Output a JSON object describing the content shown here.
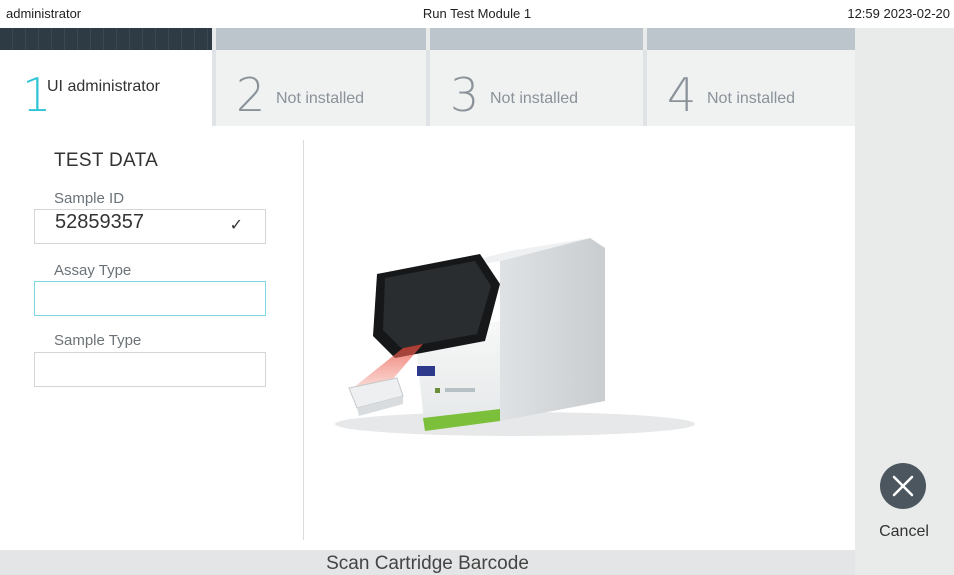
{
  "header": {
    "user": "administrator",
    "title": "Run Test Module 1",
    "datetime": "12:59 2023-02-20"
  },
  "tabs": [
    {
      "number": "1",
      "label": "UI administrator",
      "active": true
    },
    {
      "number": "2",
      "label": "Not installed",
      "active": false
    },
    {
      "number": "3",
      "label": "Not installed",
      "active": false
    },
    {
      "number": "4",
      "label": "Not installed",
      "active": false
    }
  ],
  "test_data": {
    "title": "TEST DATA",
    "sample_id": {
      "label": "Sample ID",
      "value": "52859357",
      "check": "✓"
    },
    "assay_type": {
      "label": "Assay Type",
      "value": ""
    },
    "sample_type": {
      "label": "Sample Type",
      "value": ""
    }
  },
  "actions": {
    "cancel_label": "Cancel"
  },
  "status": {
    "message": "Scan Cartridge Barcode"
  },
  "colors": {
    "accent": "#2ec4d6",
    "cancel_button": "#4b565e"
  }
}
